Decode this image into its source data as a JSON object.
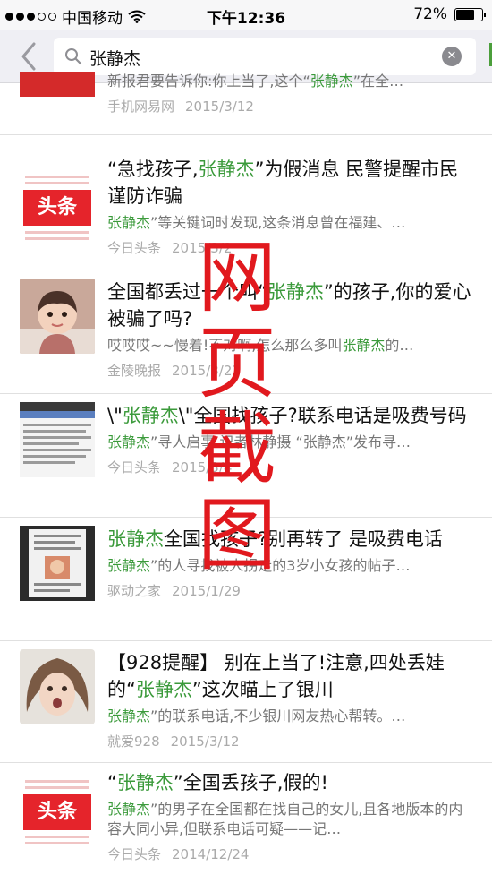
{
  "status_bar": {
    "carrier": "中国移动",
    "time": "下午12:36",
    "battery": "72%",
    "battery_level": 0.72
  },
  "search": {
    "query": "张静杰",
    "clear_icon": "clear-icon"
  },
  "results": [
    {
      "thumb": "netease-thumb",
      "title_parts": [],
      "snippet_parts": [
        "新报君要告诉你:你上当了,这个“",
        "张静杰",
        "”在全…"
      ],
      "source": "手机网易网",
      "date": "2015/3/12"
    },
    {
      "thumb": "toutiao-logo",
      "logo_text": "头条",
      "title_parts": [
        "“急找孩子,",
        "张静杰",
        "”为假消息 民警提醒市民谨防诈骗"
      ],
      "snippet_parts": [
        "",
        "张静杰",
        "”等关键词时发现,这条消息曾在福建、…"
      ],
      "source": "今日头条",
      "date": "2015/3/2"
    },
    {
      "thumb": "child-photo",
      "title_parts": [
        "全国都丢过一个叫“",
        "张静杰",
        "”的孩子,你的爱心被骗了吗?"
      ],
      "snippet_parts": [
        "哎哎哎~~慢着!不对啊,怎么那么多叫",
        "张静杰",
        "的…"
      ],
      "source": "金陵晚报",
      "date": "2015/3/23"
    },
    {
      "thumb": "phone-screenshot",
      "title_parts": [
        "\\\"",
        "张静杰",
        "\\\"全国找孩子?联系电话是吸费号码"
      ],
      "snippet_parts": [
        "",
        "张静杰",
        "”寻人启事 记者林静摄 “张静杰”发布寻…"
      ],
      "source": "今日头条",
      "date": "2015/3/4"
    },
    {
      "thumb": "poster-thumb",
      "title_parts": [
        "",
        "张静杰",
        "全国找孩子?别再转了 是吸费电话"
      ],
      "snippet_parts": [
        "",
        "张静杰",
        "”的人寻找被人拐走的3岁小女孩的帖子…"
      ],
      "source": "驱动之家",
      "date": "2015/1/29"
    },
    {
      "thumb": "girl-photo",
      "title_parts": [
        "【928提醒】 别在上当了!注意,四处丢娃的“",
        "张静杰",
        "”这次瞄上了银川"
      ],
      "snippet_parts": [
        "",
        "张静杰",
        "”的联系电话,不少银川网友热心帮转。…"
      ],
      "source": "就爱928",
      "date": "2015/3/12"
    },
    {
      "thumb": "toutiao-logo",
      "logo_text": "头条",
      "title_parts": [
        "“",
        "张静杰",
        "”全国丢孩子,假的!"
      ],
      "snippet_parts": [
        "",
        "张静杰",
        "”的男子在全国都在找自己的女儿,且各地版本的内容大同小异,但联系电话可疑——记…"
      ],
      "source": "今日头条",
      "date": "2014/12/24"
    }
  ],
  "watermark": [
    "网",
    "页",
    "截",
    "图"
  ],
  "colors": {
    "highlight": "#3b9a3b",
    "watermark": "#e1191e",
    "toutiao_red": "#e5242b"
  }
}
